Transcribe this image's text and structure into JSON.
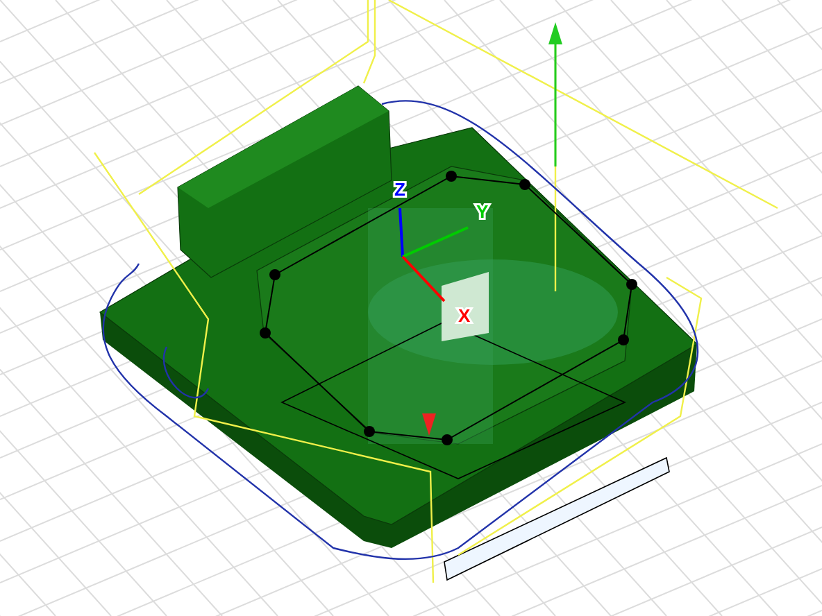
{
  "viewport": {
    "axes": [
      {
        "label": "Z",
        "color": "#0000ff"
      },
      {
        "label": "Y",
        "color": "#00cc00"
      },
      {
        "label": "X",
        "color": "#ff0000"
      }
    ]
  }
}
